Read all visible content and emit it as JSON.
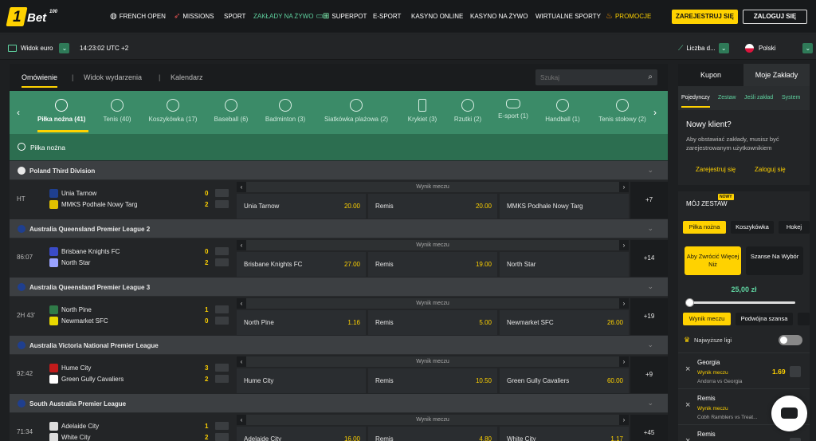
{
  "brand": {
    "logo_num": "1",
    "logo_text": "Bet",
    "logo_sup": "100"
  },
  "nav": [
    {
      "label": "FRENCH OPEN",
      "icon": "globe-icon"
    },
    {
      "label": "MISSIONS",
      "icon": "rocket-icon"
    },
    {
      "label": "SPORT"
    },
    {
      "label": "ZAKŁADY NA ŻYWO",
      "icon": "live-icon",
      "active": true
    },
    {
      "label": "SUPERPOT",
      "icon": "superpot-icon"
    },
    {
      "label": "E-SPORT"
    },
    {
      "label": "KASYNO ONLINE"
    },
    {
      "label": "KASYNO NA ŻYWO"
    },
    {
      "label": "WIRTUALNE SPORTY"
    },
    {
      "label": "PROMOCJE",
      "icon": "flame-icon",
      "accent": true
    }
  ],
  "auth": {
    "register": "ZAREJESTRUJ SIĘ",
    "login": "ZALOGUJ SIĘ"
  },
  "subbar": {
    "view_label": "Widok euro",
    "time": "14:23:02 UTC +2",
    "stats": "Liczba d...",
    "language": "Polski"
  },
  "main": {
    "tabs": [
      "Omówienie",
      "Widok wydarzenia",
      "Kalendarz"
    ],
    "search_placeholder": "Szukaj",
    "sports": [
      {
        "label": "Piłka nożna (41)",
        "active": true
      },
      {
        "label": "Tenis (40)"
      },
      {
        "label": "Koszykówka (17)"
      },
      {
        "label": "Baseball (6)"
      },
      {
        "label": "Badminton (3)"
      },
      {
        "label": "Siatkówka plażowa (2)"
      },
      {
        "label": "Krykiet (3)"
      },
      {
        "label": "Rzutki (2)"
      },
      {
        "label": "E-sport (1)"
      },
      {
        "label": "Handball (1)"
      },
      {
        "label": "Tenis stołowy (2)"
      }
    ],
    "category": "Piłka nożna",
    "odds_header": "Wynik meczu",
    "leagues": [
      {
        "name": "Poland Third Division",
        "flag_color": "#e8e8e8",
        "match": {
          "time": "HT",
          "home": "Unia Tarnow",
          "away": "MMKS Podhale Nowy Targ",
          "home_score": "0",
          "away_score": "2",
          "odds": [
            {
              "n": "Unia Tarnow",
              "v": "20.00"
            },
            {
              "n": "Remis",
              "v": "20.00"
            },
            {
              "n": "MMKS Podhale Nowy Targ",
              "v": ""
            }
          ],
          "more": "+7"
        }
      },
      {
        "name": "Australia Queensland Premier League 2",
        "flag_color": "#1f3f8f",
        "match": {
          "time": "86:07",
          "home": "Brisbane Knights FC",
          "away": "North Star",
          "home_score": "0",
          "away_score": "2",
          "odds": [
            {
              "n": "Brisbane Knights FC",
              "v": "27.00"
            },
            {
              "n": "Remis",
              "v": "19.00"
            },
            {
              "n": "North Star",
              "v": ""
            }
          ],
          "more": "+14"
        }
      },
      {
        "name": "Australia Queensland Premier League 3",
        "flag_color": "#1f3f8f",
        "match": {
          "time": "2H 43'",
          "home": "North Pine",
          "away": "Newmarket SFC",
          "home_score": "1",
          "away_score": "0",
          "odds": [
            {
              "n": "North Pine",
              "v": "1.16"
            },
            {
              "n": "Remis",
              "v": "5.00"
            },
            {
              "n": "Newmarket SFC",
              "v": "26.00"
            }
          ],
          "more": "+19"
        }
      },
      {
        "name": "Australia Victoria National Premier League",
        "flag_color": "#1f3f8f",
        "match": {
          "time": "92:42",
          "home": "Hume City",
          "away": "Green Gully Cavaliers",
          "home_score": "3",
          "away_score": "2",
          "odds": [
            {
              "n": "Hume City",
              "v": ""
            },
            {
              "n": "Remis",
              "v": "10.50"
            },
            {
              "n": "Green Gully Cavaliers",
              "v": "60.00"
            }
          ],
          "more": "+9"
        }
      },
      {
        "name": "South Australia Premier League",
        "flag_color": "#1f3f8f",
        "match": {
          "time": "71:34",
          "home": "Adelaide City",
          "away": "White City",
          "home_score": "1",
          "away_score": "2",
          "odds": [
            {
              "n": "Adelaide City",
              "v": "16.00"
            },
            {
              "n": "Remis",
              "v": "4.80"
            },
            {
              "n": "White City",
              "v": "1.17"
            }
          ],
          "more": "+45"
        }
      }
    ]
  },
  "coupon": {
    "tabs": [
      "Kupon",
      "Moje Zakłady"
    ],
    "subtabs": [
      "Pojedynczy",
      "Zestaw",
      "Jeśli zakład",
      "System"
    ],
    "new_title": "Nowy klient?",
    "new_text": "Aby obstawiać zakłady, musisz być zarejestrowanym użytkownikiem",
    "register": "Zarejestruj się",
    "login": "Zaloguj się"
  },
  "myset": {
    "title": "MÓJ ZESTAW",
    "badge": "NOWY",
    "sports": [
      "Piłka nożna",
      "Koszykówka",
      "Hokej"
    ],
    "choice1": "Aby Zwrócić Więcej Niż",
    "choice2": "Szanse Na Wybór",
    "amount": "25,00 zł",
    "slider_level": 0.02,
    "markets": [
      "Wynik meczu",
      "Podwójna szansa"
    ],
    "top_leagues": "Najwyższe ligi",
    "selections": [
      {
        "team": "Georgia",
        "market": "Wynik meczu",
        "event": "Andorra vs Georgia",
        "odd": "1.69"
      },
      {
        "team": "Remis",
        "market": "Wynik meczu",
        "event": "Cobh Ramblers vs Treat...",
        "odd": ""
      },
      {
        "team": "Remis",
        "market": "",
        "event": "",
        "odd": ""
      }
    ]
  }
}
